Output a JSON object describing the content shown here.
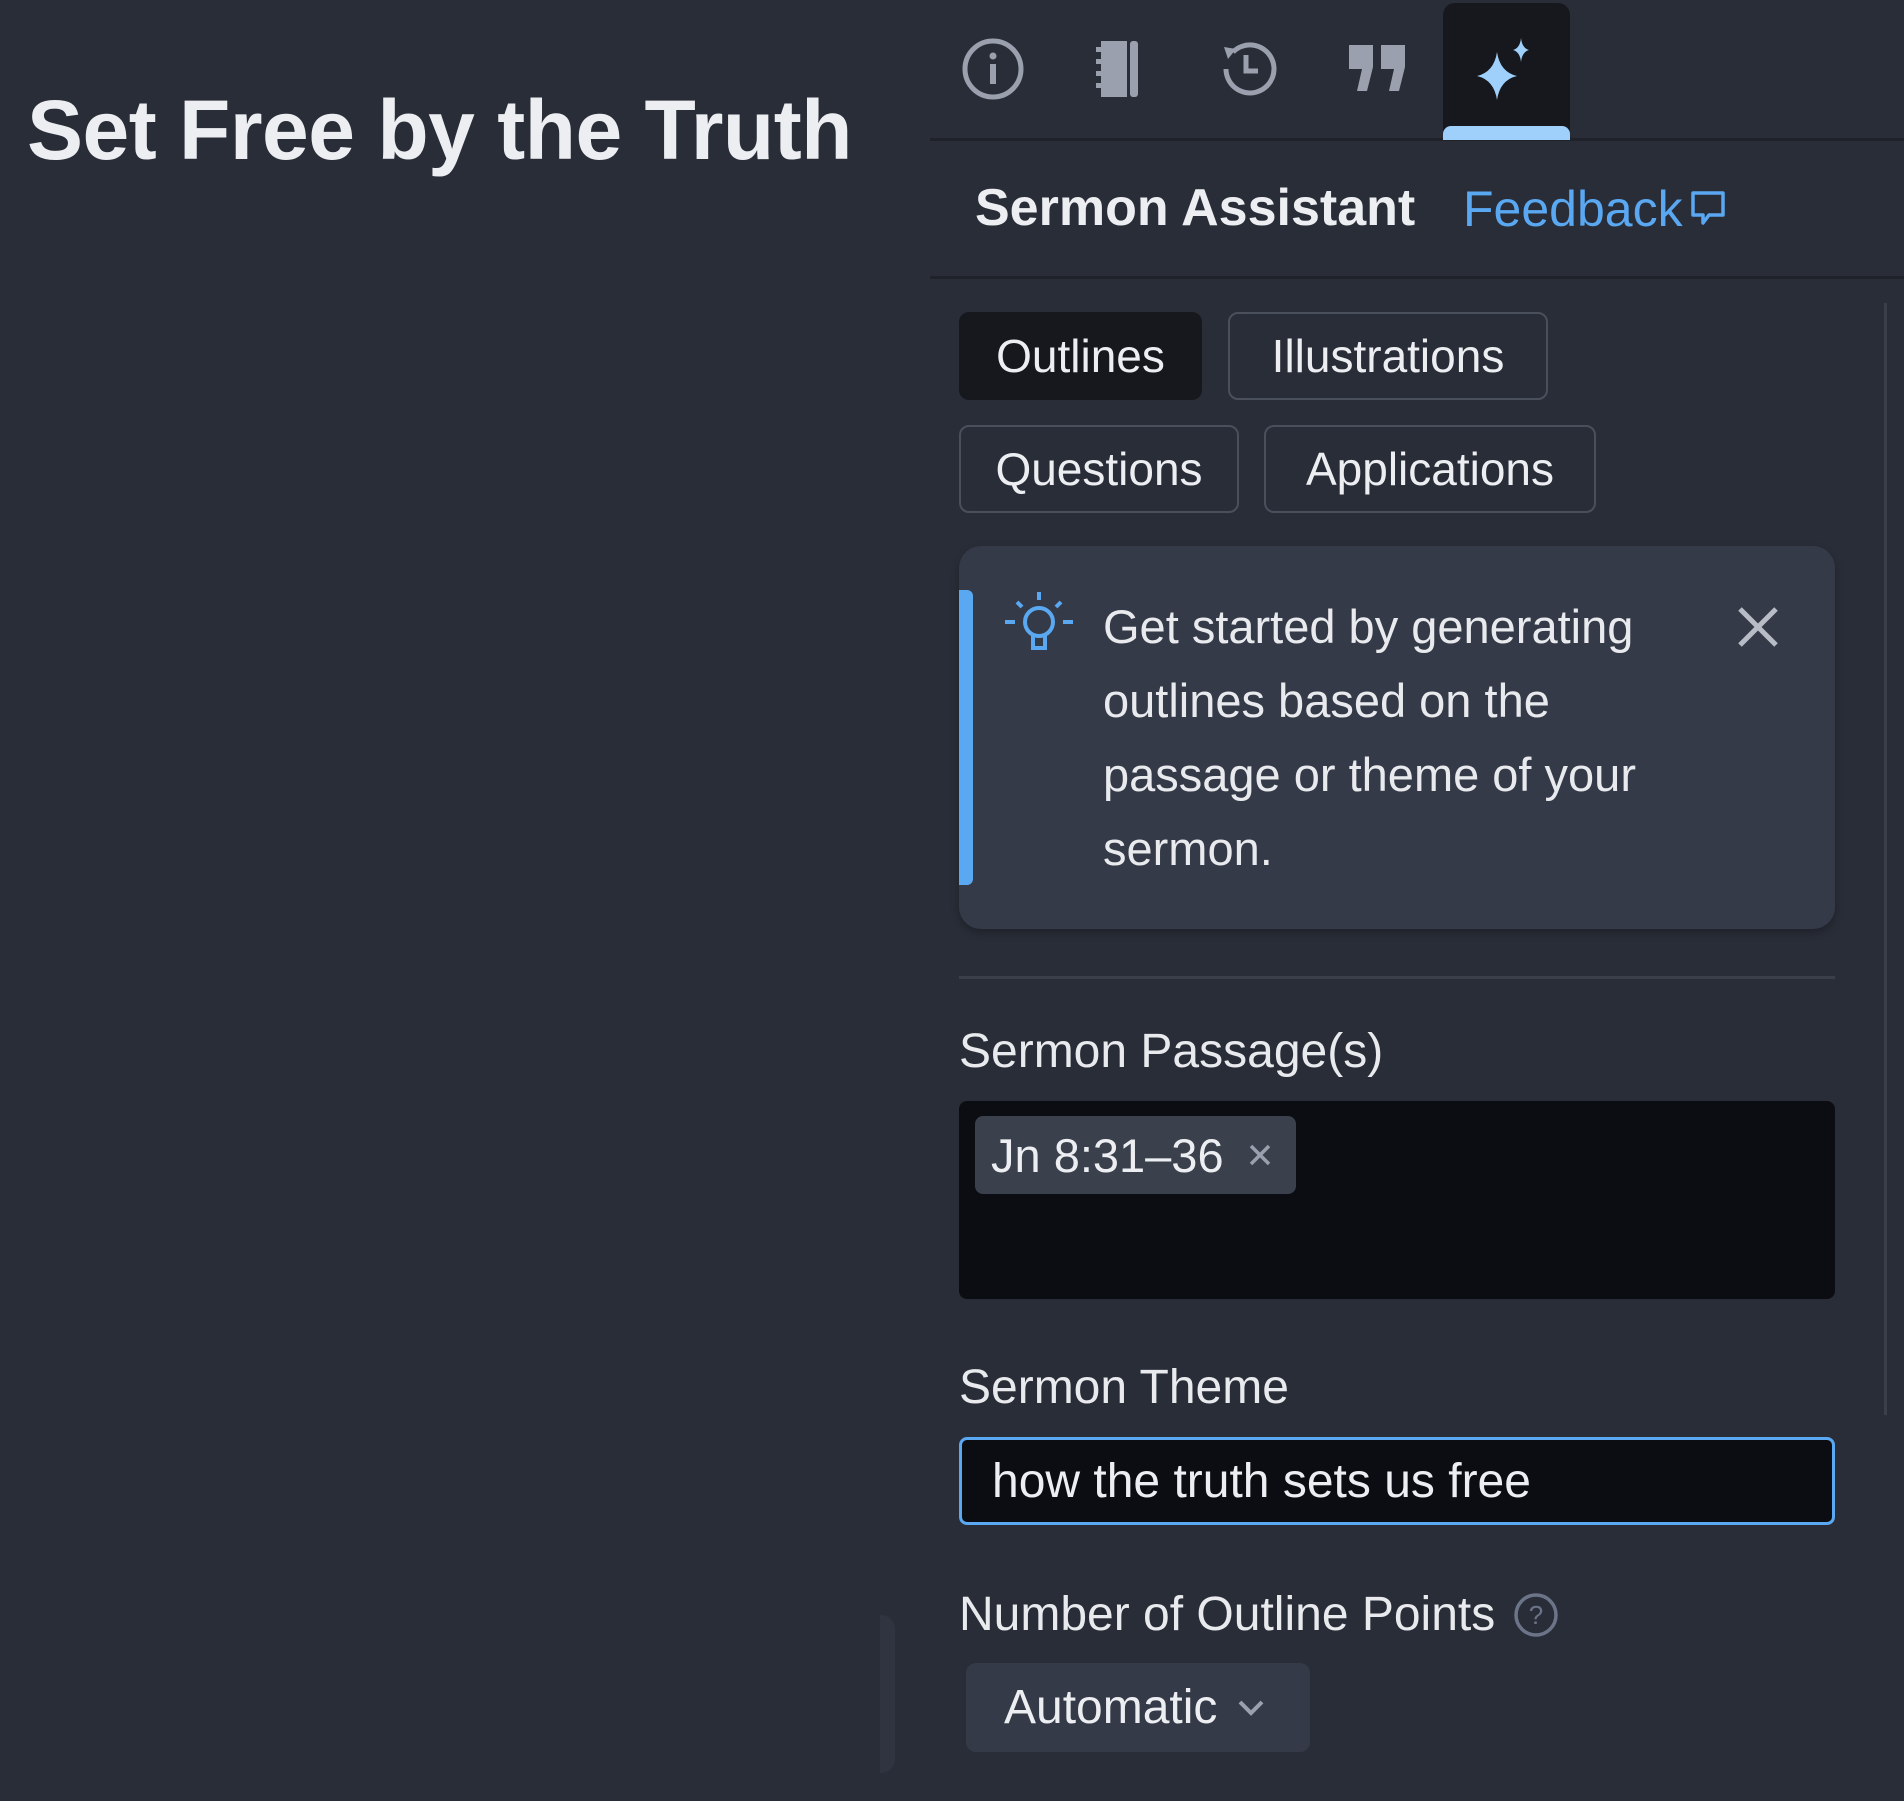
{
  "document": {
    "title": "Set Free by the Truth"
  },
  "panel": {
    "tabs": [
      {
        "icon": "info-icon"
      },
      {
        "icon": "notebook-icon"
      },
      {
        "icon": "history-icon"
      },
      {
        "icon": "quote-icon"
      },
      {
        "icon": "sparkle-icon",
        "active": true
      }
    ],
    "title": "Sermon Assistant",
    "feedback_label": "Feedback",
    "modes": [
      "Outlines",
      "Illustrations",
      "Questions",
      "Applications"
    ],
    "selected_mode": "Outlines",
    "tip": {
      "text": "Get started by generating outlines based on the passage or theme of your sermon."
    },
    "passage": {
      "label": "Sermon Passage(s)",
      "chips": [
        "Jn 8:31–36"
      ]
    },
    "theme": {
      "label": "Sermon Theme",
      "value": "how the truth sets us free"
    },
    "outline_points": {
      "label": "Number of Outline Points",
      "value": "Automatic"
    }
  },
  "colors": {
    "accent": "#5aa8f2",
    "active_tab": "#9fd0fb",
    "background": "#292d37"
  }
}
